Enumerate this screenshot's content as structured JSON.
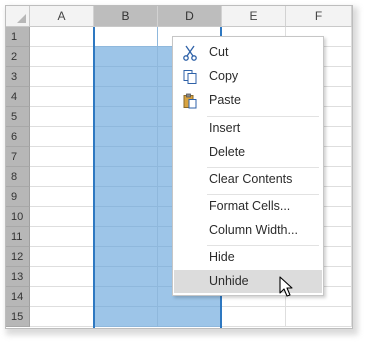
{
  "columns": [
    {
      "label": "A",
      "selected": false
    },
    {
      "label": "B",
      "selected": true
    },
    {
      "label": "D",
      "selected": true
    },
    {
      "label": "E",
      "selected": false
    },
    {
      "label": "F",
      "selected": false
    }
  ],
  "rows": [
    "1",
    "2",
    "3",
    "4",
    "5",
    "6",
    "7",
    "8",
    "9",
    "10",
    "11",
    "12",
    "13",
    "14",
    "15"
  ],
  "colors": {
    "selection_fill": "#9dc5e8",
    "selection_border": "#2e78c1",
    "header_selected": "#bdbdbd",
    "menu_hover": "#dcdcdc"
  },
  "context_menu": {
    "items": [
      {
        "label": "Cut",
        "icon": "scissors-icon"
      },
      {
        "label": "Copy",
        "icon": "copy-icon"
      },
      {
        "label": "Paste",
        "icon": "paste-icon"
      },
      {
        "label": "Insert"
      },
      {
        "label": "Delete"
      },
      {
        "label": "Clear Contents"
      },
      {
        "label": "Format Cells..."
      },
      {
        "label": "Column Width..."
      },
      {
        "label": "Hide"
      },
      {
        "label": "Unhide",
        "hovered": true
      }
    ]
  }
}
